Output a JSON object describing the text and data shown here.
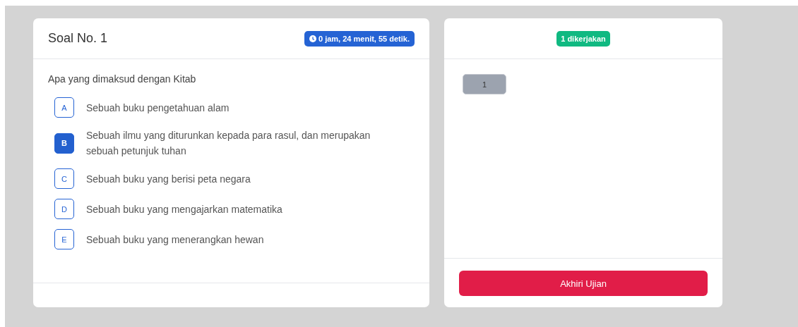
{
  "question": {
    "title": "Soal No. 1",
    "timer": "0 jam, 24 menit, 55 detik.",
    "text": "Apa yang dimaksud dengan Kitab",
    "options": [
      {
        "letter": "A",
        "text": "Sebuah buku pengetahuan alam",
        "selected": false
      },
      {
        "letter": "B",
        "text": "Sebuah ilmu yang diturunkan kepada para rasul, dan merupakan sebuah petunjuk tuhan",
        "selected": true
      },
      {
        "letter": "C",
        "text": "Sebuah buku yang berisi peta negara",
        "selected": false
      },
      {
        "letter": "D",
        "text": "Sebuah buku yang mengajarkan matematika",
        "selected": false
      },
      {
        "letter": "E",
        "text": "Sebuah buku yang menerangkan hewan",
        "selected": false
      }
    ]
  },
  "navigator": {
    "badge": "1 dikerjakan",
    "numbers": [
      "1"
    ],
    "finish_button": "Akhiri Ujian"
  }
}
